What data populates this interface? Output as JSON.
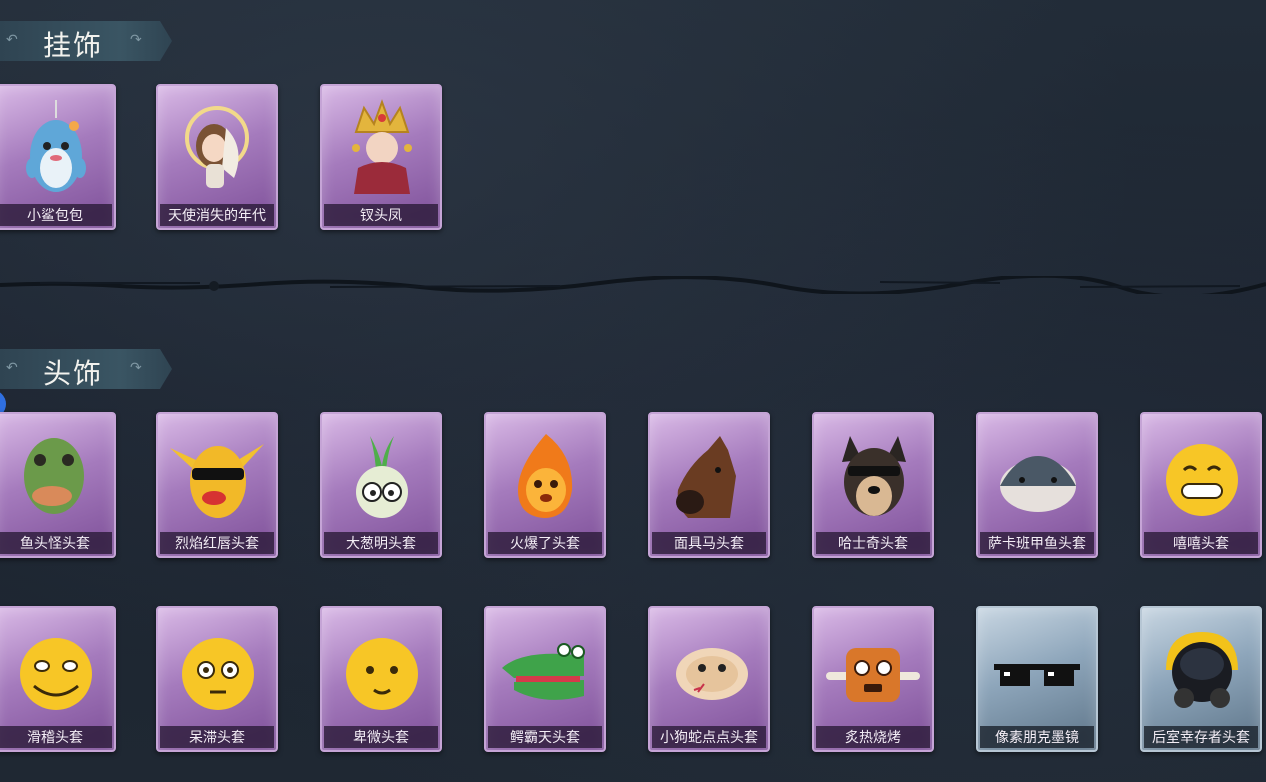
{
  "sections": {
    "charms": {
      "title": "挂饰",
      "items": [
        {
          "label": "小鲨包包",
          "icon": "shark-bag-charm"
        },
        {
          "label": "天使消失的年代",
          "icon": "angel-doll-charm"
        },
        {
          "label": "钗头凤",
          "icon": "phoenix-crown-charm"
        }
      ]
    },
    "headwear": {
      "title": "头饰",
      "rows": [
        [
          {
            "label": "鱼头怪头套",
            "icon": "fish-head-mask"
          },
          {
            "label": "烈焰红唇头套",
            "icon": "yellow-red-lips-mask"
          },
          {
            "label": "大葱明头套",
            "icon": "scallion-mask"
          },
          {
            "label": "火爆了头套",
            "icon": "fire-mask"
          },
          {
            "label": "面具马头套",
            "icon": "horse-mask"
          },
          {
            "label": "哈士奇头套",
            "icon": "husky-mask"
          },
          {
            "label": "萨卡班甲鱼头套",
            "icon": "sacabambaspis-mask"
          },
          {
            "label": "嘻嘻头套",
            "icon": "grin-emoji-mask"
          }
        ],
        [
          {
            "label": "滑稽头套",
            "icon": "funny-emoji-mask"
          },
          {
            "label": "呆滞头套",
            "icon": "dazed-emoji-mask"
          },
          {
            "label": "卑微头套",
            "icon": "humble-emoji-mask"
          },
          {
            "label": "鳄霸天头套",
            "icon": "crocodile-mask"
          },
          {
            "label": "小狗蛇点点头套",
            "icon": "snake-mask"
          },
          {
            "label": "炙热烧烤",
            "icon": "grilled-meat-mask"
          },
          {
            "label": "像素朋克墨镜",
            "icon": "pixel-sunglasses",
            "rarity": "blue"
          },
          {
            "label": "后室幸存者头套",
            "icon": "gas-mask-helmet",
            "rarity": "blue"
          }
        ]
      ]
    }
  },
  "colors": {
    "purple_card": "#a57bbd",
    "blue_card": "#8ea6bb",
    "background": "#1e2733",
    "tab": "#3a5563"
  }
}
